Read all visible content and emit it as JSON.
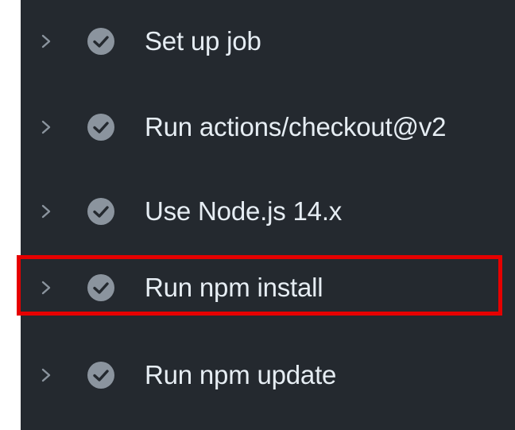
{
  "steps": [
    {
      "label": "Set up job",
      "status": "success"
    },
    {
      "label": "Run actions/checkout@v2",
      "status": "success"
    },
    {
      "label": "Use Node.js 14.x",
      "status": "success"
    },
    {
      "label": "Run npm install",
      "status": "success",
      "highlighted": true
    },
    {
      "label": "Run npm update",
      "status": "success"
    }
  ],
  "icons": {
    "expand": "chevron-right-icon",
    "status": "check-circle-icon"
  },
  "colors": {
    "background": "#24292f",
    "text": "#e6edf3",
    "check_fill": "#8b949e",
    "highlight": "#e60000"
  }
}
